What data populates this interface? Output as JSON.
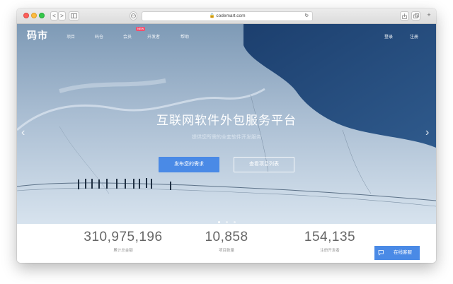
{
  "browser": {
    "url": "codemart.com",
    "buttons": [
      "<",
      ">"
    ]
  },
  "site": {
    "logo": "码市",
    "nav": [
      "项目",
      "码仓",
      "会员",
      "开发者",
      "帮助"
    ],
    "nav_badge": "NEW",
    "login": "登录",
    "register": "注册"
  },
  "hero": {
    "title": "互联网软件外包服务平台",
    "subtitle": "提供您所需的全套软件开发服务",
    "primary_button": "发布您的需求",
    "secondary_button": "查看项目列表",
    "prev_arrow": "‹",
    "next_arrow": "›",
    "slide_count": 3,
    "active_slide": 1
  },
  "stats": [
    {
      "value": "310,975,196",
      "label": "累计总金额"
    },
    {
      "value": "10,858",
      "label": "项目数量"
    },
    {
      "value": "154,135",
      "label": "注册开发者"
    }
  ],
  "support_button": "在线客服",
  "colors": {
    "accent": "#4a8ae6",
    "badge": "#f0506e",
    "lake": "#2b4f7f"
  }
}
